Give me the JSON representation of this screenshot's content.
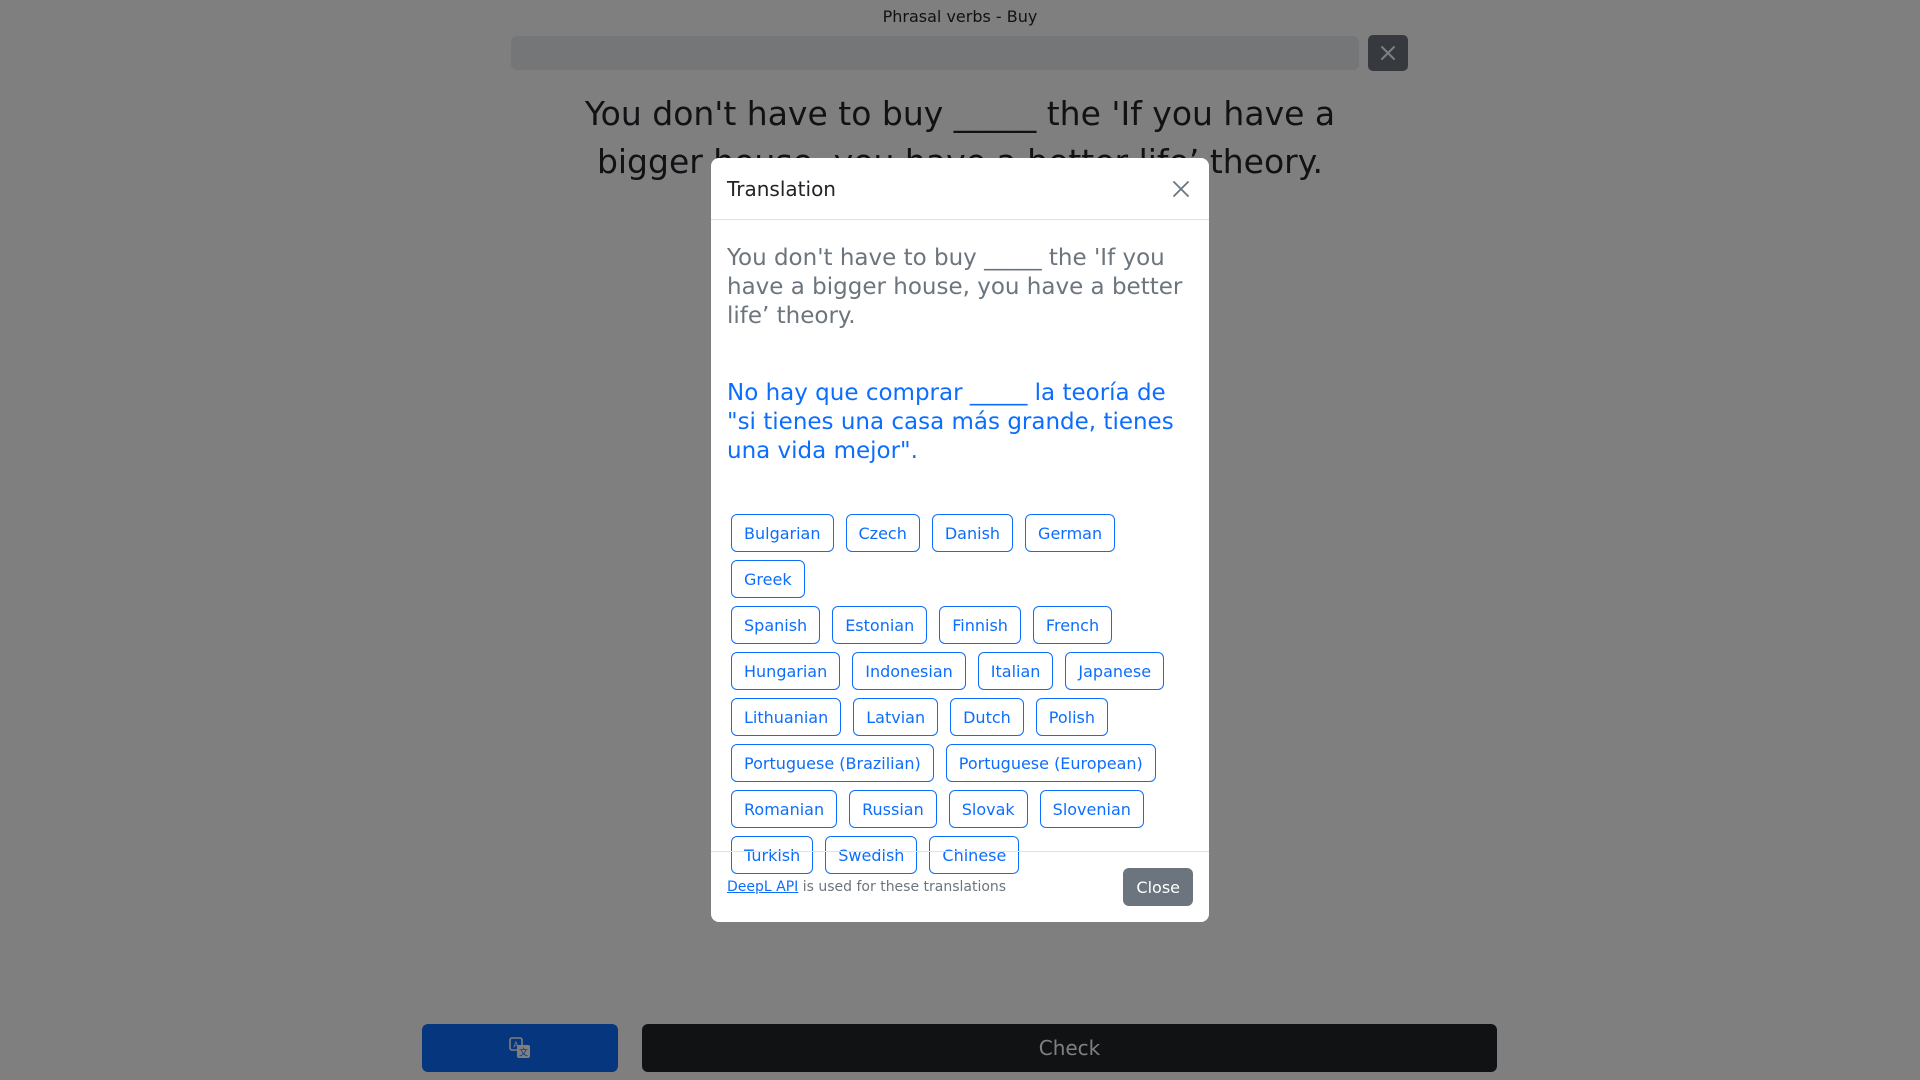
{
  "page": {
    "title": "Phrasal verbs - Buy",
    "progress_fraction": 0,
    "question": "You don't have to buy _____ the 'If you have a bigger house, you have a better life’ theory.",
    "check_label": "Check"
  },
  "modal": {
    "title": "Translation",
    "source_text": "You don't have to buy _____ the 'If you have a bigger house, you have a better life’ theory.",
    "translated_text": "No hay que comprar _____ la teoría de \"si tienes una casa más grande, tienes una vida mejor\".",
    "languages": [
      [
        "Bulgarian",
        "Czech",
        "Danish",
        "German",
        "Greek"
      ],
      [
        "Spanish",
        "Estonian",
        "Finnish",
        "French"
      ],
      [
        "Hungarian",
        "Indonesian",
        "Italian",
        "Japanese"
      ],
      [
        "Lithuanian",
        "Latvian",
        "Dutch",
        "Polish"
      ],
      [
        "Portuguese (Brazilian)",
        "Portuguese (European)"
      ],
      [
        "Romanian",
        "Russian",
        "Slovak",
        "Slovenian"
      ],
      [
        "Turkish",
        "Swedish",
        "Chinese"
      ]
    ],
    "footer_link": "DeepL API",
    "footer_text": " is used for these translations",
    "close_label": "Close"
  },
  "colors": {
    "primary": "#0d6efd",
    "secondary": "#6c757d",
    "dark": "#212529"
  },
  "icons": {
    "exit": "close-icon",
    "modal_close": "close-icon",
    "translate": "translate-icon"
  }
}
